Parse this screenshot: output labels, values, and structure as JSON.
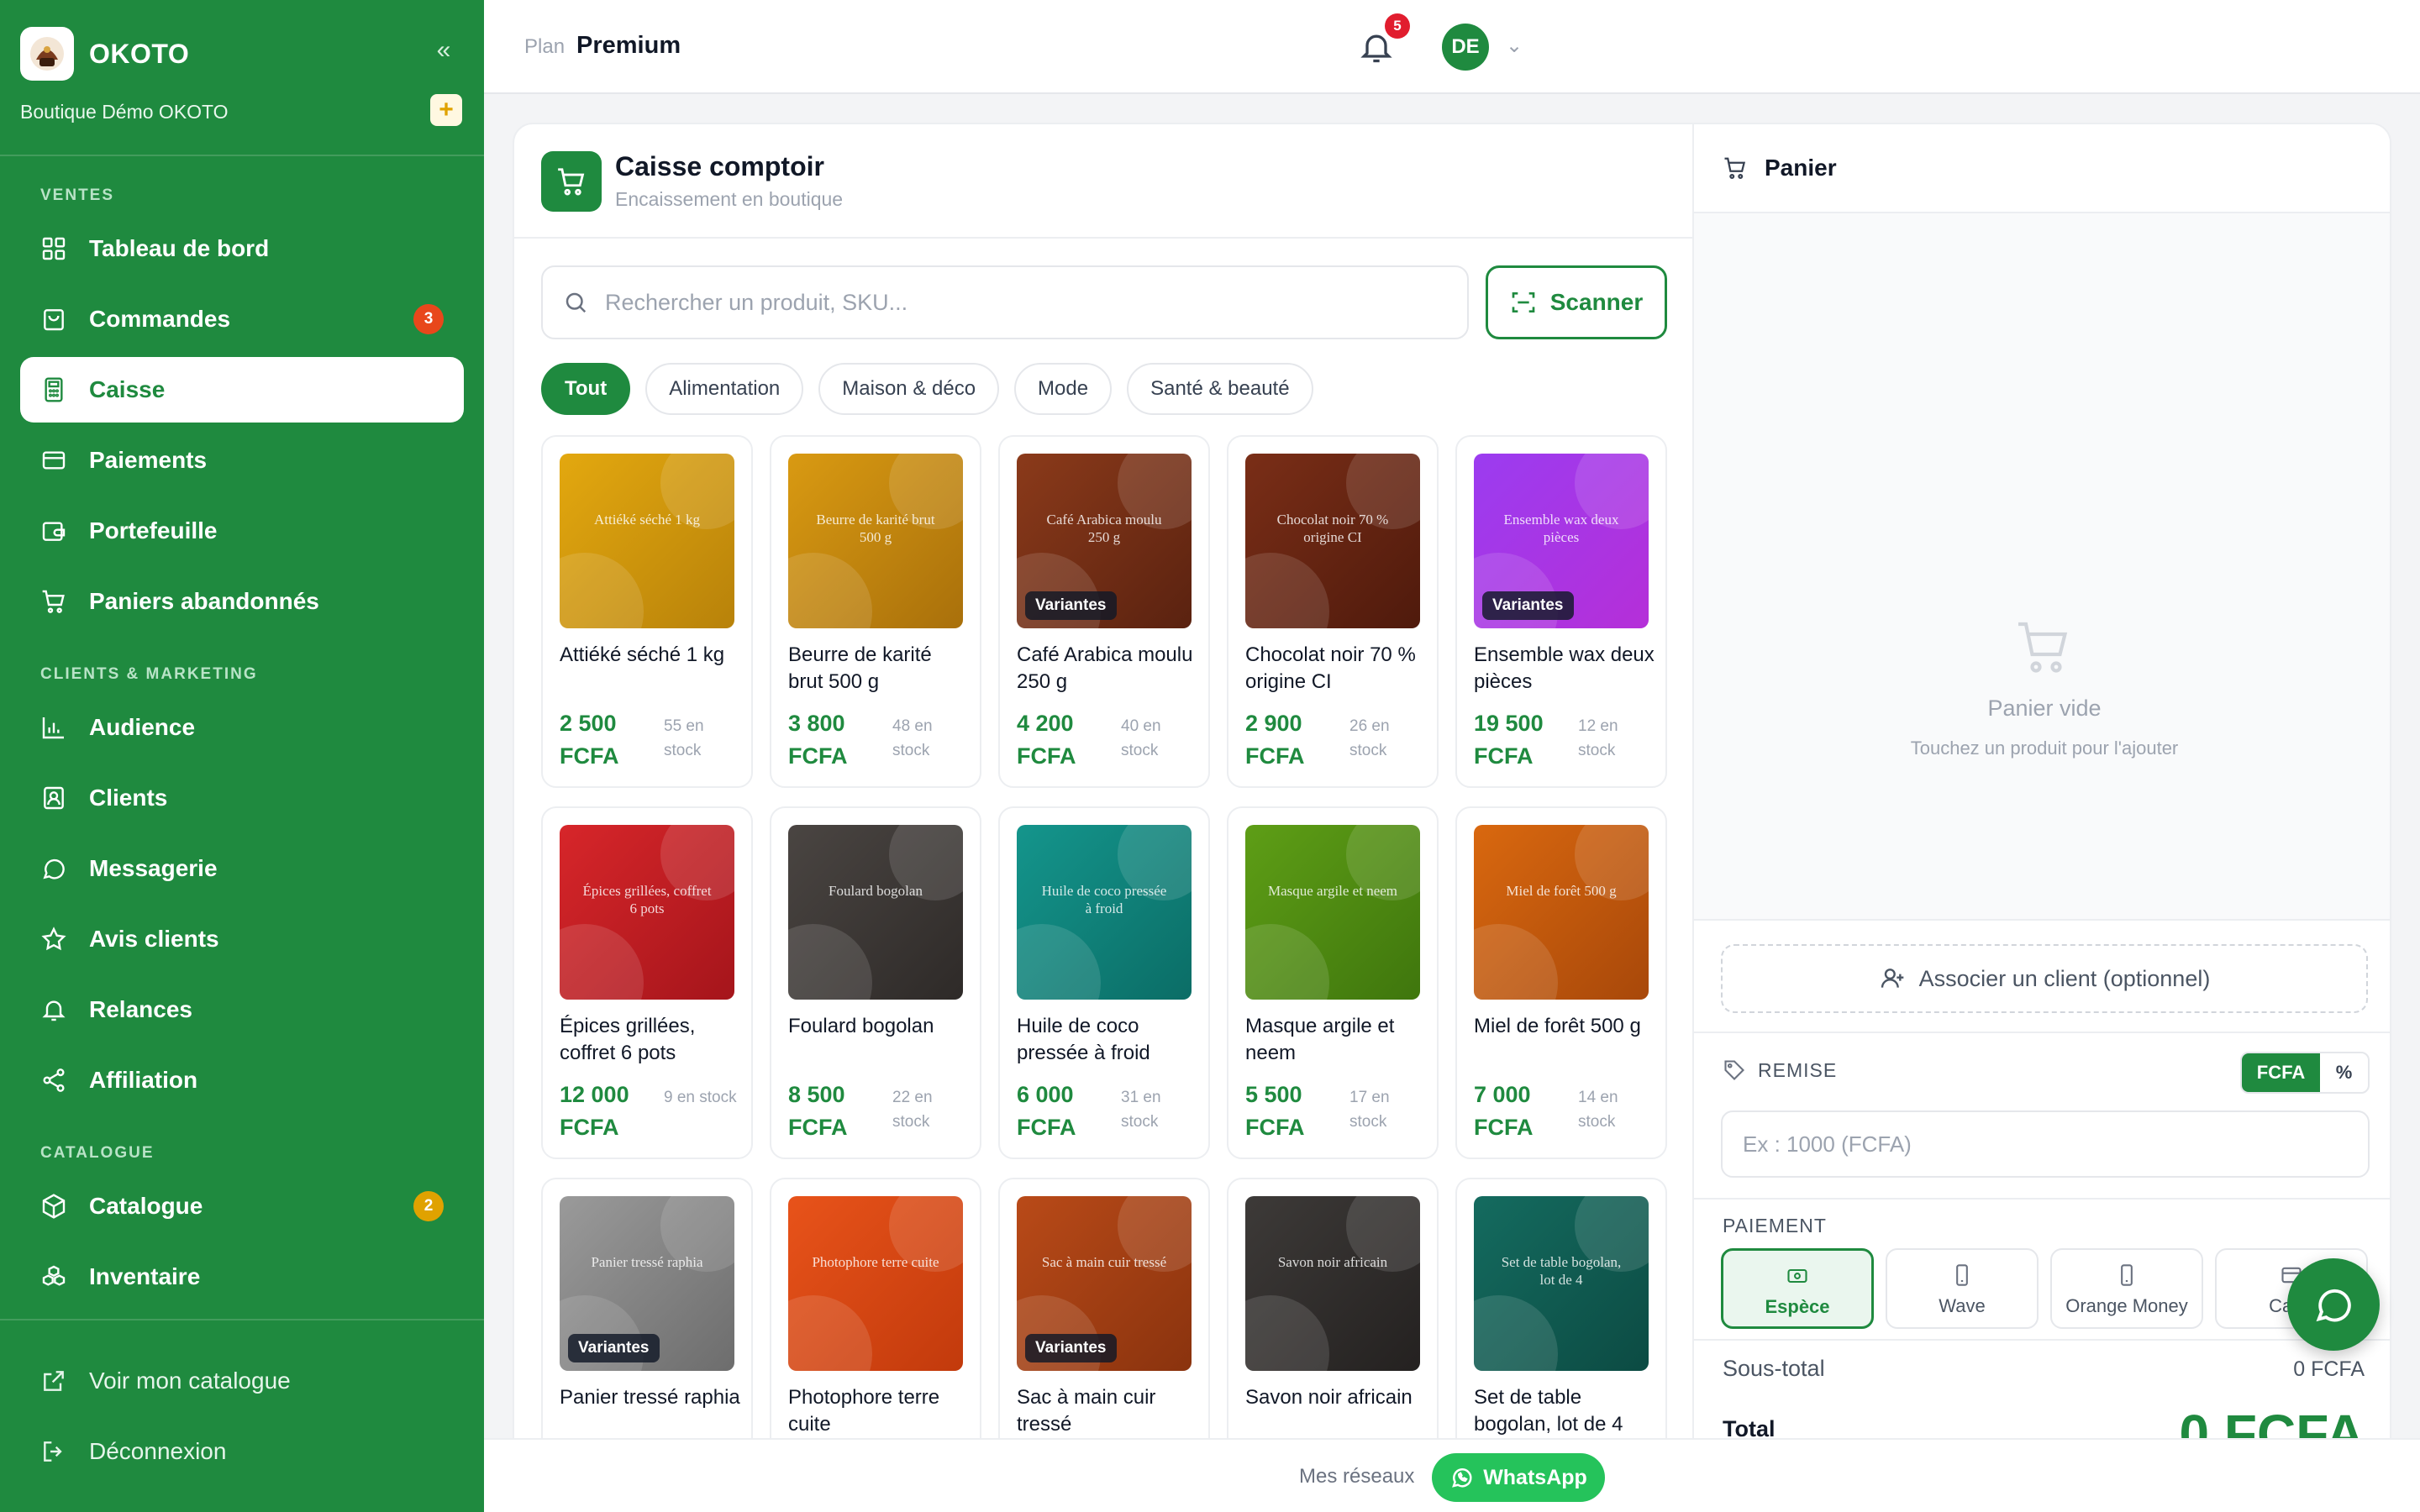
{
  "brand": {
    "name": "OKOTO",
    "shop": "Boutique Démo OKOTO",
    "add_icon": "plus-icon",
    "collapse_icon": "double-chevron-left-icon"
  },
  "sidebar": {
    "sections": [
      {
        "label": "VENTES"
      },
      {
        "label": "CLIENTS & MARKETING"
      },
      {
        "label": "CATALOGUE"
      }
    ],
    "items": [
      {
        "label": "Tableau de bord",
        "icon": "dashboard-icon"
      },
      {
        "label": "Commandes",
        "icon": "bag-icon",
        "badge": "3",
        "badge_color": "#e8471b"
      },
      {
        "label": "Caisse",
        "icon": "calculator-icon",
        "active": true
      },
      {
        "label": "Paiements",
        "icon": "card-icon"
      },
      {
        "label": "Portefeuille",
        "icon": "wallet-icon"
      },
      {
        "label": "Paniers abandonnés",
        "icon": "cart-icon"
      },
      {
        "label": "Audience",
        "icon": "chart-icon"
      },
      {
        "label": "Clients",
        "icon": "contact-icon"
      },
      {
        "label": "Messagerie",
        "icon": "chat-icon"
      },
      {
        "label": "Avis clients",
        "icon": "star-icon"
      },
      {
        "label": "Relances",
        "icon": "bell-icon"
      },
      {
        "label": "Affiliation",
        "icon": "share-icon"
      },
      {
        "label": "Catalogue",
        "icon": "box-icon",
        "badge": "2",
        "badge_color": "#e0a200"
      },
      {
        "label": "Inventaire",
        "icon": "boxes-icon"
      }
    ],
    "footer": [
      {
        "label": "Voir mon catalogue",
        "icon": "external-link-icon"
      },
      {
        "label": "Déconnexion",
        "icon": "logout-icon"
      }
    ]
  },
  "topbar": {
    "plan_label": "Plan",
    "plan_value": "Premium",
    "notifications": "5",
    "avatar": "DE"
  },
  "pos": {
    "title": "Caisse comptoir",
    "subtitle": "Encaissement en boutique",
    "search_placeholder": "Rechercher un produit, SKU...",
    "search_value": "",
    "scan_label": "Scanner",
    "categories": [
      {
        "label": "Tout",
        "active": true
      },
      {
        "label": "Alimentation"
      },
      {
        "label": "Maison & déco"
      },
      {
        "label": "Mode"
      },
      {
        "label": "Santé & beauté"
      }
    ],
    "variant_label": "Variantes",
    "products": [
      {
        "thumb": "Attiéké séché 1 kg",
        "name": "Attiéké séché 1 kg",
        "price": "2 500 FCFA",
        "stock": "55 en stock",
        "c1": "#e3a80f",
        "c2": "#b8820a",
        "variants": false
      },
      {
        "thumb": "Beurre de karité brut 500 g",
        "name": "Beurre de karité brut 500 g",
        "price": "3 800 FCFA",
        "stock": "48 en stock",
        "c1": "#d99a12",
        "c2": "#a9700b",
        "variants": false
      },
      {
        "thumb": "Café Arabica moulu 250 g",
        "name": "Café Arabica moulu 250 g",
        "price": "4 200 FCFA",
        "stock": "40 en stock",
        "c1": "#8b3a1a",
        "c2": "#5a2210",
        "variants": true
      },
      {
        "thumb": "Chocolat noir 70 % origine CI",
        "name": "Chocolat noir 70 % origine CI",
        "price": "2 900 FCFA",
        "stock": "26 en stock",
        "c1": "#7a2e17",
        "c2": "#4f1a0c",
        "variants": false
      },
      {
        "thumb": "Ensemble wax deux pièces",
        "name": "Ensemble wax deux pièces",
        "price": "19 500 FCFA",
        "stock": "12 en stock",
        "c1": "#9b3cf0",
        "c2": "#b52fd8",
        "variants": true
      },
      {
        "thumb": "Épices grillées, coffret 6 pots",
        "name": "Épices grillées, coffret 6 pots",
        "price": "12 000 FCFA",
        "stock": "9 en stock",
        "c1": "#d7262a",
        "c2": "#a5151b",
        "variants": false
      },
      {
        "thumb": "Foulard bogolan",
        "name": "Foulard bogolan",
        "price": "8 500 FCFA",
        "stock": "22 en stock",
        "c1": "#4a4542",
        "c2": "#2e2a28",
        "variants": false
      },
      {
        "thumb": "Huile de coco pressée à froid",
        "name": "Huile de coco pressée à froid",
        "price": "6 000 FCFA",
        "stock": "31 en stock",
        "c1": "#14958c",
        "c2": "#0b6d66",
        "variants": false
      },
      {
        "thumb": "Masque argile et neem",
        "name": "Masque argile et neem",
        "price": "5 500 FCFA",
        "stock": "17 en stock",
        "c1": "#5e9e16",
        "c2": "#3f760d",
        "variants": false
      },
      {
        "thumb": "Miel de forêt 500 g",
        "name": "Miel de forêt 500 g",
        "price": "7 000 FCFA",
        "stock": "14 en stock",
        "c1": "#d9680f",
        "c2": "#a8480a",
        "variants": false
      },
      {
        "thumb": "Panier tressé raphia",
        "name": "Panier tressé raphia",
        "price": "",
        "stock": "",
        "c1": "#9a9a9a",
        "c2": "#6d6d6d",
        "variants": true
      },
      {
        "thumb": "Photophore terre cuite",
        "name": "Photophore terre cuite",
        "price": "",
        "stock": "",
        "c1": "#e8531a",
        "c2": "#c23a0c",
        "variants": false
      },
      {
        "thumb": "Sac à main cuir tressé",
        "name": "Sac à main cuir tressé",
        "price": "",
        "stock": "",
        "c1": "#b94a18",
        "c2": "#8a330e",
        "variants": true
      },
      {
        "thumb": "Savon noir africain",
        "name": "Savon noir africain",
        "price": "",
        "stock": "",
        "c1": "#3d3a38",
        "c2": "#242120",
        "variants": false
      },
      {
        "thumb": "Set de table bogolan, lot de 4",
        "name": "Set de table bogolan, lot de 4",
        "price": "",
        "stock": "",
        "c1": "#146b5f",
        "c2": "#0c4b43",
        "variants": false
      }
    ]
  },
  "cart": {
    "title": "Panier",
    "empty_title": "Panier vide",
    "empty_sub": "Touchez un produit pour l'ajouter",
    "client_label": "Associer un client (optionnel)",
    "remise_label": "REMISE",
    "remise_fcfa": "FCFA",
    "remise_pct": "%",
    "remise_placeholder": "Ex : 1000 (FCFA)",
    "pay_label": "PAIEMENT",
    "pay_methods": [
      {
        "label": "Espèce",
        "icon": "cash-icon",
        "active": true
      },
      {
        "label": "Wave",
        "icon": "phone-icon"
      },
      {
        "label": "Orange Money",
        "icon": "phone-icon"
      },
      {
        "label": "Carte",
        "icon": "card-icon"
      }
    ],
    "subtotal_label": "Sous-total",
    "subtotal_value": "0 FCFA",
    "total_label": "Total",
    "total_value": "0 FCFA"
  },
  "footer": {
    "label": "Mes réseaux",
    "whatsapp": "WhatsApp"
  },
  "colors": {
    "brand_green": "#1f8a3f",
    "whatsapp_green": "#25c35b",
    "alert_red": "#e11d2e"
  }
}
